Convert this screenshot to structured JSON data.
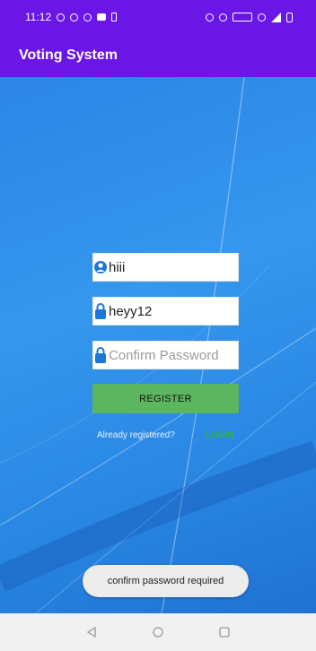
{
  "status_bar": {
    "time": "11:12"
  },
  "app_bar": {
    "title": "Voting System"
  },
  "form": {
    "username_value": "hiii",
    "password_value": "heyy12",
    "confirm_placeholder": "Confirm Password",
    "register_label": "REGISTER",
    "already_text": "Already registered?",
    "login_label": "LOGIN"
  },
  "toast": {
    "message": "confirm password required"
  },
  "colors": {
    "accent": "#6a16e6",
    "button": "#5cb660",
    "link": "#2db24a",
    "icon": "#1a78d8"
  }
}
